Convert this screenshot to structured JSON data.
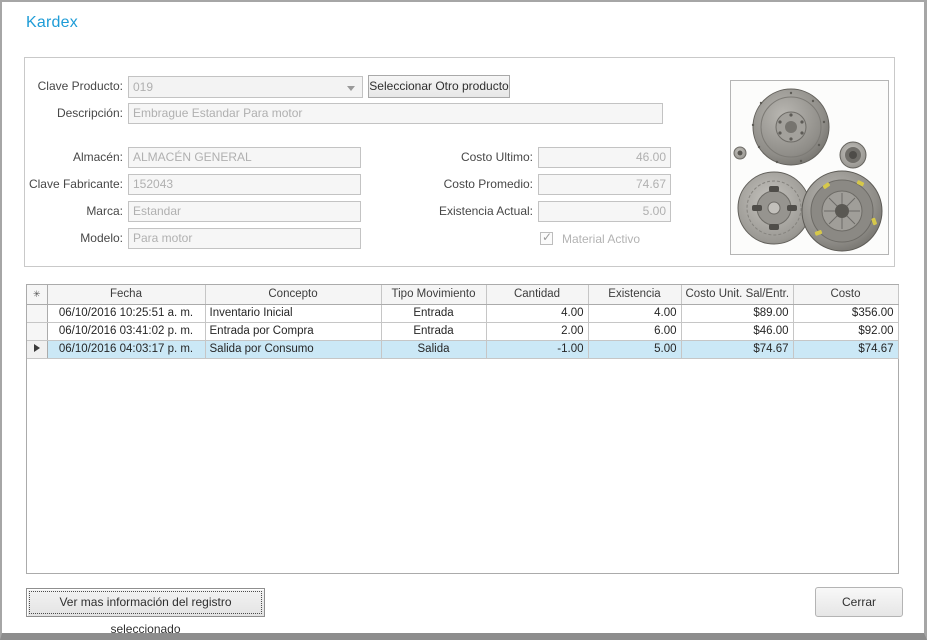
{
  "window": {
    "title": "Kardex",
    "accent_color": "#1e9cd7"
  },
  "form": {
    "clave_producto": {
      "label": "Clave Producto:",
      "value": "019"
    },
    "seleccionar_button_label": "Seleccionar Otro producto",
    "descripcion": {
      "label": "Descripción:",
      "value": "Embrague Estandar Para motor"
    },
    "almacen": {
      "label": "Almacén:",
      "value": "ALMACÉN GENERAL"
    },
    "clave_fabricante": {
      "label": "Clave Fabricante:",
      "value": "152043"
    },
    "marca": {
      "label": "Marca:",
      "value": "Estandar"
    },
    "modelo": {
      "label": "Modelo:",
      "value": "Para motor"
    },
    "costo_ultimo": {
      "label": "Costo Ultimo:",
      "value": "46.00"
    },
    "costo_promedio": {
      "label": "Costo Promedio:",
      "value": "74.67"
    },
    "existencia_actual": {
      "label": "Existencia Actual:",
      "value": "5.00"
    },
    "material_activo": {
      "label": "Material Activo",
      "checked": true,
      "checkmark": "✓"
    },
    "product_image": "clutch-kit-photo"
  },
  "grid": {
    "header_marker": "✳",
    "columns": [
      "Fecha",
      "Concepto",
      "Tipo Movimiento",
      "Cantidad",
      "Existencia",
      "Costo Unit. Sal/Entr.",
      "Costo"
    ],
    "selected_row_color": "#cbe8f6",
    "rows": [
      {
        "fecha": "06/10/2016 10:25:51 a. m.",
        "concepto": "Inventario Inicial",
        "tipo": "Entrada",
        "cantidad": "4.00",
        "existencia": "4.00",
        "costo_unit": "$89.00",
        "costo": "$356.00"
      },
      {
        "fecha": "06/10/2016 03:41:02 p. m.",
        "concepto": "Entrada por Compra",
        "tipo": "Entrada",
        "cantidad": "2.00",
        "existencia": "6.00",
        "costo_unit": "$46.00",
        "costo": "$92.00"
      },
      {
        "fecha": "06/10/2016 04:03:17 p. m.",
        "concepto": "Salida por Consumo",
        "tipo": "Salida",
        "cantidad": "-1.00",
        "existencia": "5.00",
        "costo_unit": "$74.67",
        "costo": "$74.67"
      }
    ]
  },
  "footer": {
    "ver_mas_label": "Ver mas información del registro seleccionado",
    "cerrar_label": "Cerrar"
  }
}
